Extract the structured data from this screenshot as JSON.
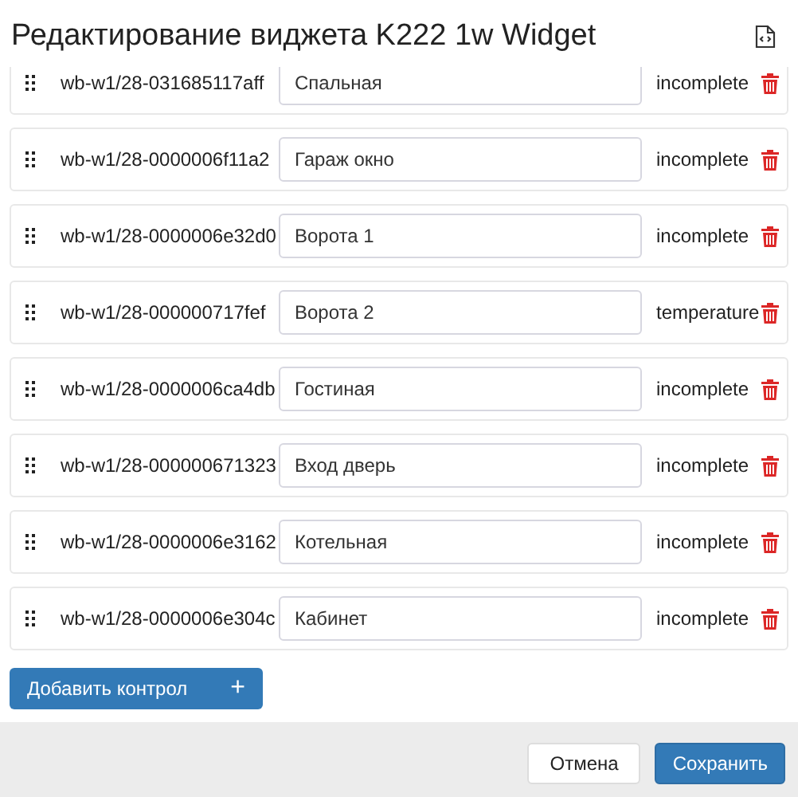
{
  "dialog": {
    "title": "Редактирование виджета K222 1w Widget"
  },
  "controls": [
    {
      "id": "wb-w1/28-031685117aff",
      "name": "Спальная",
      "type": "incomplete"
    },
    {
      "id": "wb-w1/28-0000006f11a2",
      "name": "Гараж окно",
      "type": "incomplete"
    },
    {
      "id": "wb-w1/28-0000006e32d0",
      "name": "Ворота 1",
      "type": "incomplete"
    },
    {
      "id": "wb-w1/28-000000717fef",
      "name": "Ворота 2",
      "type": "temperature"
    },
    {
      "id": "wb-w1/28-0000006ca4db",
      "name": "Гостиная",
      "type": "incomplete"
    },
    {
      "id": "wb-w1/28-000000671323",
      "name": "Вход дверь",
      "type": "incomplete"
    },
    {
      "id": "wb-w1/28-0000006e3162",
      "name": "Котельная",
      "type": "incomplete"
    },
    {
      "id": "wb-w1/28-0000006e304c",
      "name": "Кабинет",
      "type": "incomplete"
    }
  ],
  "add_button": {
    "label": "Добавить контрол",
    "icon": "+"
  },
  "footer_buttons": [
    {
      "label": "Отмена",
      "kind": "secondary"
    },
    {
      "label": "Сохранить",
      "kind": "primary"
    }
  ]
}
